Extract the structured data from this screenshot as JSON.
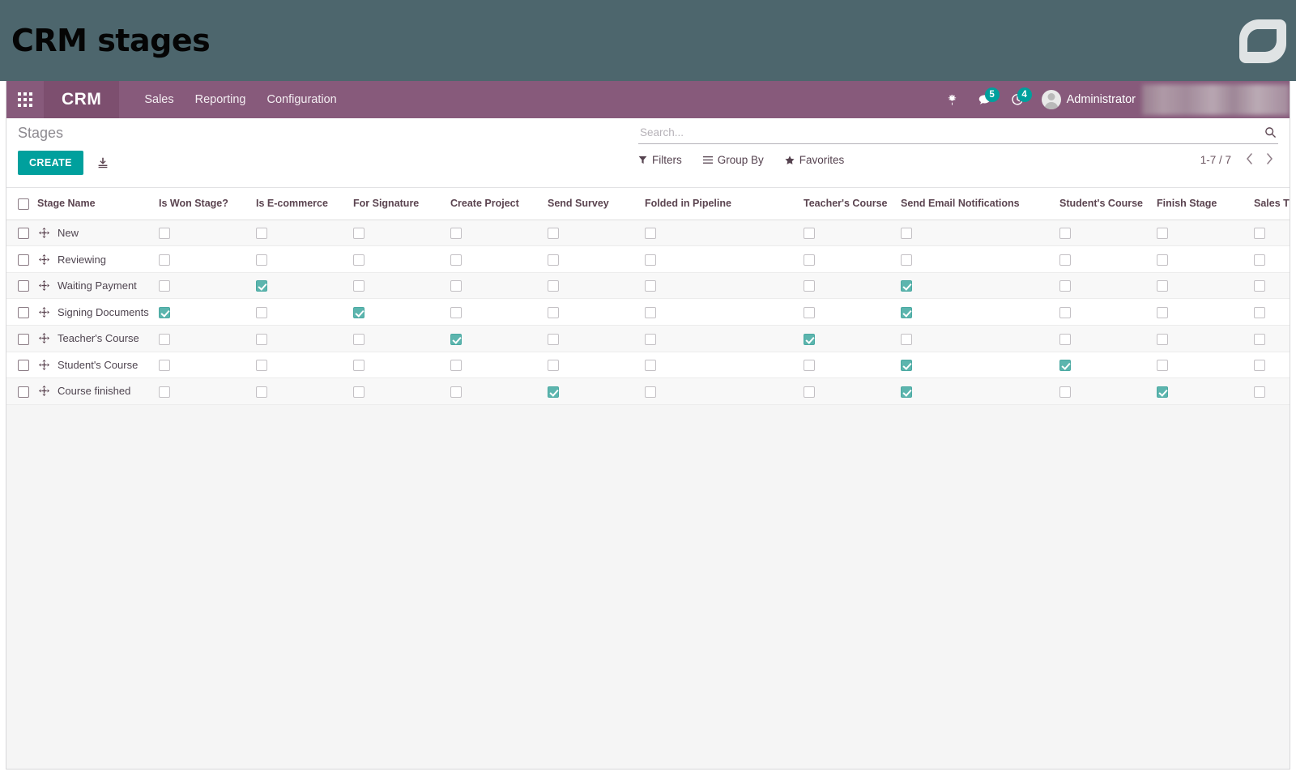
{
  "banner": {
    "title": "CRM stages",
    "logo_icon": "odoo-leaf-logo",
    "bg_color": "#4d666d"
  },
  "navbar": {
    "apps_icon": "apps-grid-icon",
    "brand": "CRM",
    "menus": [
      "Sales",
      "Reporting",
      "Configuration"
    ],
    "debug_icon": "bug-icon",
    "messages_icon": "chat-bubble-icon",
    "messages_count": "5",
    "activities_icon": "clock-activity-icon",
    "activities_count": "4",
    "avatar_icon": "user-avatar",
    "username": "Administrator",
    "accent_color": "#875a7b",
    "badge_color": "#00a09d"
  },
  "control_panel": {
    "breadcrumb": "Stages",
    "create_label": "CREATE",
    "import_icon": "import-download-icon",
    "search": {
      "value": "",
      "placeholder": "Search..."
    },
    "search_icon": "search-icon",
    "filters_label": "Filters",
    "filters_icon": "filter-funnel-icon",
    "groupby_label": "Group By",
    "groupby_icon": "hamburger-lines-icon",
    "favorites_label": "Favorites",
    "favorites_icon": "star-icon",
    "pager_count": "1-7 / 7",
    "pager_prev_icon": "chevron-left-icon",
    "pager_next_icon": "chevron-right-icon"
  },
  "list": {
    "columns": [
      "Stage Name",
      "Is Won Stage?",
      "Is E-commerce",
      "For Signature",
      "Create Project",
      "Send Survey",
      "Folded in Pipeline",
      "Teacher's Course",
      "Send Email Notifications",
      "Student's Course",
      "Finish Stage",
      "Sales T"
    ],
    "select_all_checked": false,
    "rows": [
      {
        "name": "New",
        "selected": false,
        "values": [
          false,
          false,
          false,
          false,
          false,
          false,
          false,
          false,
          false,
          false,
          false
        ]
      },
      {
        "name": "Reviewing",
        "selected": false,
        "values": [
          false,
          false,
          false,
          false,
          false,
          false,
          false,
          false,
          false,
          false,
          false
        ]
      },
      {
        "name": "Waiting Payment",
        "selected": false,
        "values": [
          false,
          true,
          false,
          false,
          false,
          false,
          false,
          true,
          false,
          false,
          false
        ]
      },
      {
        "name": "Signing Documents",
        "selected": false,
        "values": [
          true,
          false,
          true,
          false,
          false,
          false,
          false,
          true,
          false,
          false,
          false
        ]
      },
      {
        "name": "Teacher's Course",
        "selected": false,
        "values": [
          false,
          false,
          false,
          true,
          false,
          false,
          true,
          false,
          false,
          false,
          false
        ]
      },
      {
        "name": "Student's Course",
        "selected": false,
        "values": [
          false,
          false,
          false,
          false,
          false,
          false,
          false,
          true,
          true,
          false,
          false
        ]
      },
      {
        "name": "Course finished",
        "selected": false,
        "values": [
          false,
          false,
          false,
          false,
          true,
          false,
          false,
          true,
          false,
          true,
          false
        ]
      }
    ],
    "drag_handle_icon": "drag-move-icon",
    "checked_color": "#5cb5ae"
  }
}
